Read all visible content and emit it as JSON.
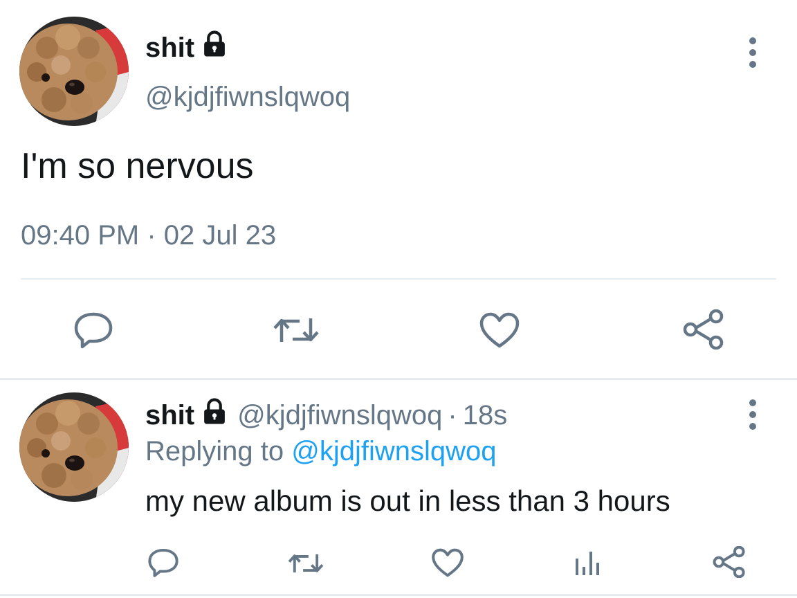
{
  "colors": {
    "text_primary": "#14171a",
    "text_secondary": "#657786",
    "link": "#1da1f2",
    "divider": "#e6ecf0",
    "icon": "#657786"
  },
  "main_tweet": {
    "display_name": "shit",
    "handle": "@kjdjfiwnslqwoq",
    "text": "I'm so nervous",
    "meta": "09:40 PM · 02 Jul 23",
    "icons": {
      "lock": "lock-icon",
      "more": "more-vertical-icon",
      "reply": "reply-icon",
      "retweet": "retweet-icon",
      "like": "heart-icon",
      "share": "share-icon"
    }
  },
  "reply_tweet": {
    "display_name": "shit",
    "handle": "@kjdjfiwnslqwoq",
    "separator": "·",
    "time": "18s",
    "replying_prefix": "Replying to",
    "replying_handle": "@kjdjfiwnslqwoq",
    "text": "my new album is out in less than 3 hours",
    "icons": {
      "lock": "lock-icon",
      "more": "more-vertical-icon",
      "reply": "reply-icon",
      "retweet": "retweet-icon",
      "like": "heart-icon",
      "analytics": "analytics-icon",
      "share": "share-icon"
    }
  }
}
